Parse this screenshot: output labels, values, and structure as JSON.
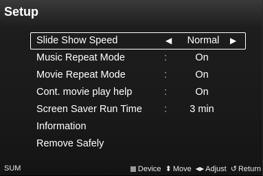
{
  "title": "Setup",
  "menu": {
    "selected": {
      "label": "Slide Show Speed",
      "value": "Normal"
    },
    "items": [
      {
        "label": "Music Repeat Mode",
        "colon": ":",
        "value": "On"
      },
      {
        "label": "Movie Repeat Mode",
        "colon": ":",
        "value": "On"
      },
      {
        "label": "Cont. movie play help",
        "colon": ":",
        "value": "On"
      },
      {
        "label": "Screen Saver Run Time",
        "colon": ":",
        "value": "3 min"
      },
      {
        "label": "Information"
      },
      {
        "label": "Remove Safely"
      }
    ]
  },
  "footer": {
    "sum": "SUM",
    "device": "Device",
    "move": "Move",
    "adjust": "Adjust",
    "return": "Return"
  },
  "icons": {
    "left_arrow": "left-arrow-icon",
    "right_arrow": "right-arrow-icon",
    "device": "device-square-icon",
    "move": "up-down-icon",
    "adjust": "left-right-icon",
    "return": "return-icon"
  }
}
